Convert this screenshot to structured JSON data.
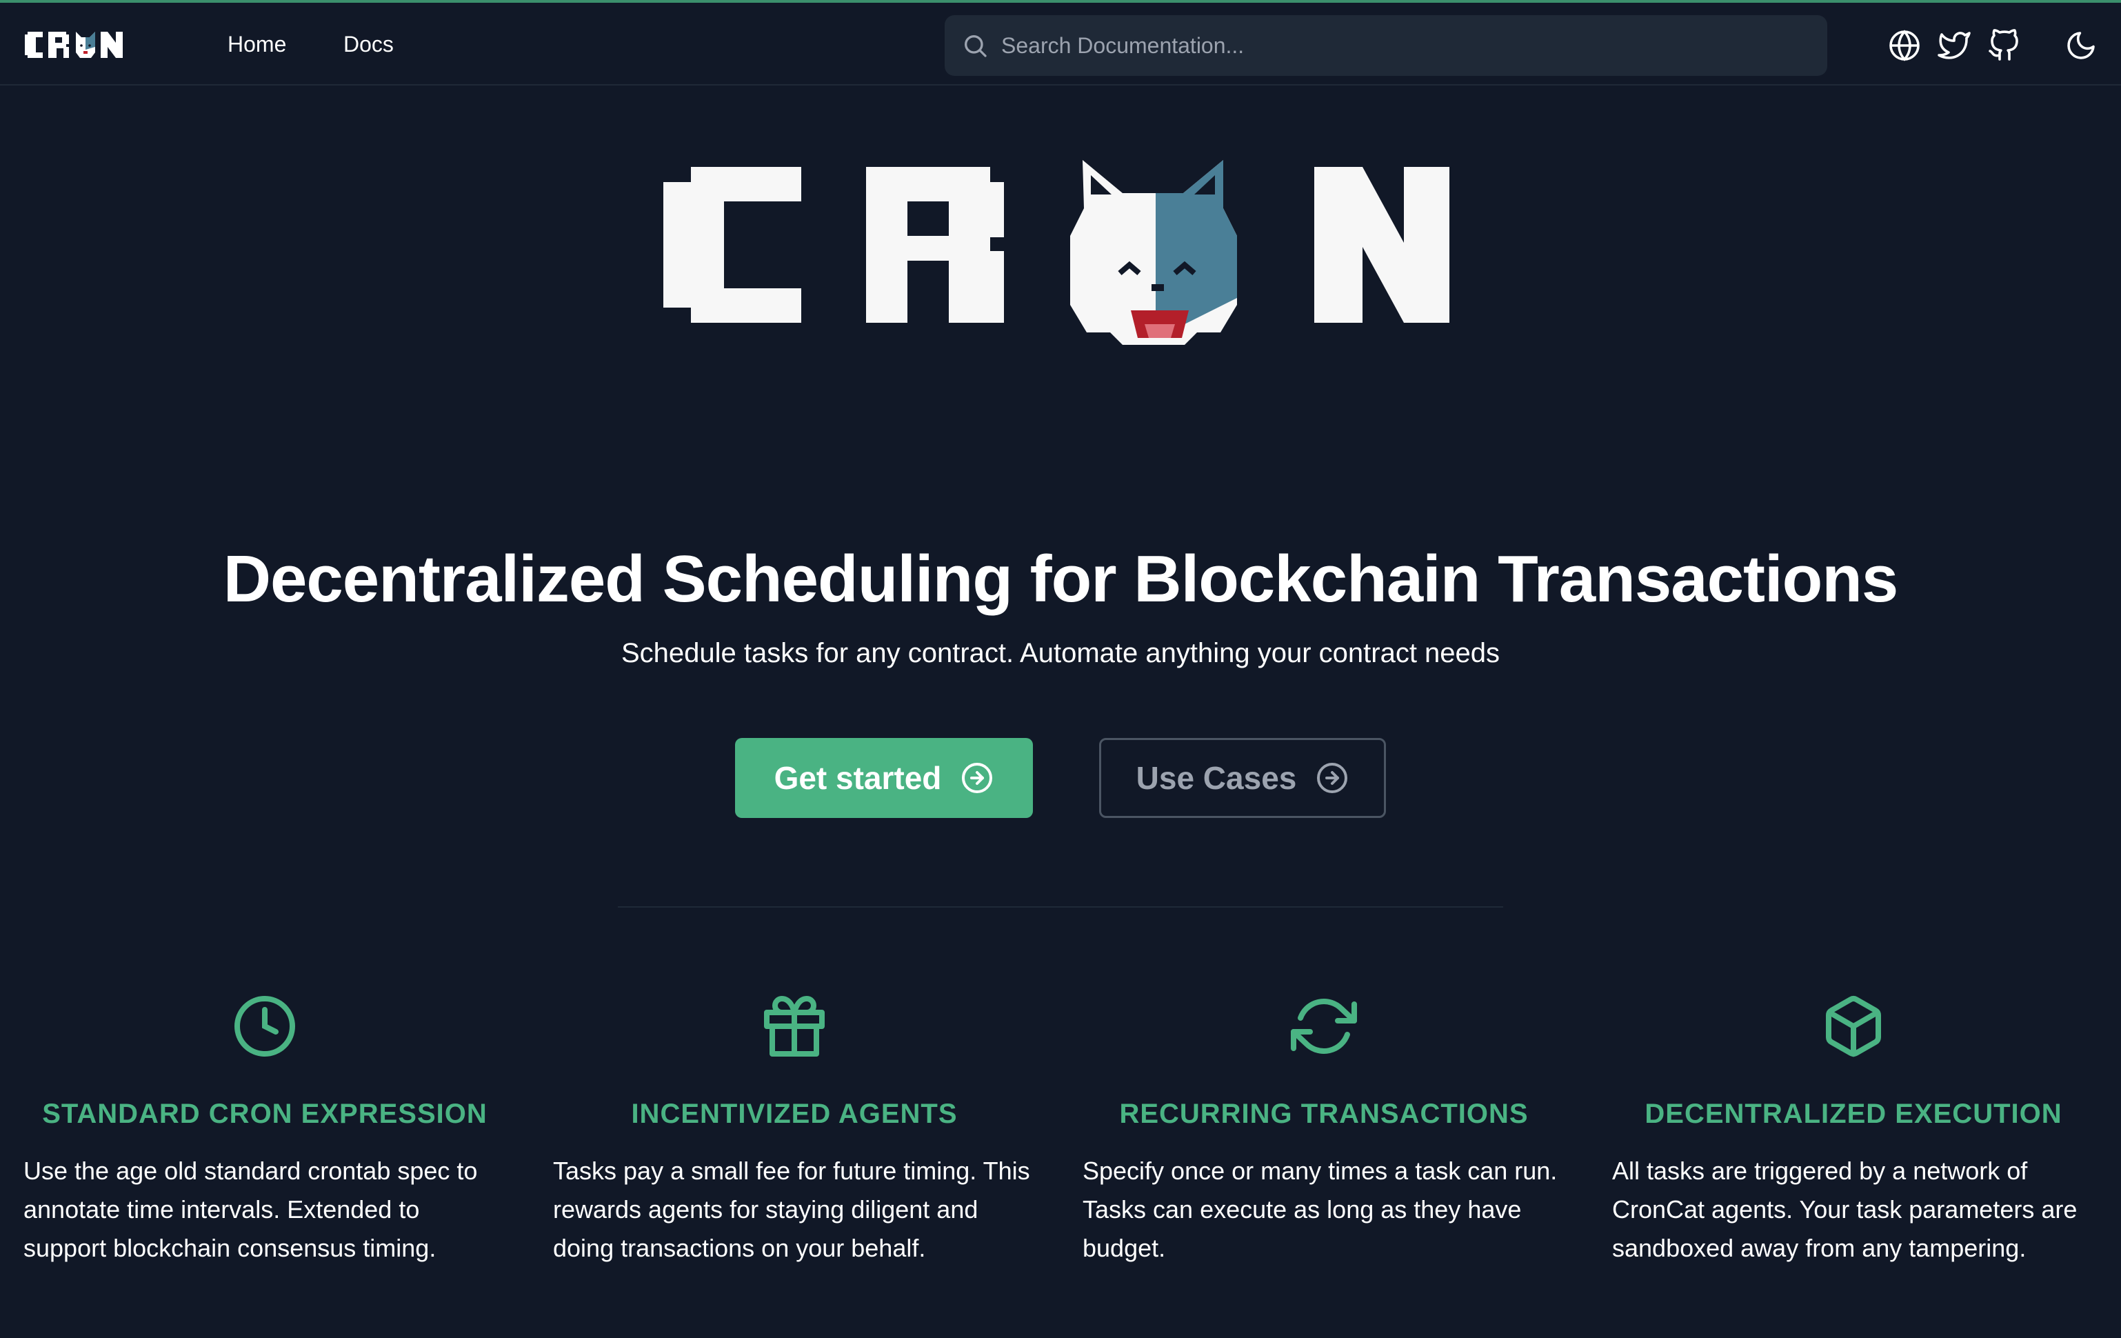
{
  "nav": {
    "brand": "CRON",
    "links": [
      "Home",
      "Docs"
    ],
    "search_placeholder": "Search Documentation...",
    "icons": [
      "globe-icon",
      "twitter-icon",
      "github-icon",
      "moon-icon"
    ]
  },
  "hero": {
    "logo_text": "CRON",
    "title": "Decentralized Scheduling for Blockchain Transactions",
    "subtitle": "Schedule tasks for any contract. Automate anything your contract needs",
    "primary_button": "Get started",
    "secondary_button": "Use Cases"
  },
  "features": [
    {
      "icon": "clock-icon",
      "title": "STANDARD CRON EXPRESSION",
      "text": "Use the age old standard crontab spec to annotate time intervals. Extended to support blockchain consensus timing."
    },
    {
      "icon": "gift-icon",
      "title": "INCENTIVIZED AGENTS",
      "text": "Tasks pay a small fee for future timing. This rewards agents for staying diligent and doing transactions on your behalf."
    },
    {
      "icon": "refresh-icon",
      "title": "RECURRING TRANSACTIONS",
      "text": "Specify once or many times a task can run. Tasks can execute as long as they have budget."
    },
    {
      "icon": "cube-icon",
      "title": "DECENTRALIZED EXECUTION",
      "text": "All tasks are triggered by a network of CronCat agents. Your task parameters are sandboxed away from any tampering."
    }
  ],
  "colors": {
    "background": "#111827",
    "accent": "#4ab383",
    "search_bg": "#1f2937",
    "muted": "#9ca3af",
    "cat_blue": "#4a7f97"
  }
}
